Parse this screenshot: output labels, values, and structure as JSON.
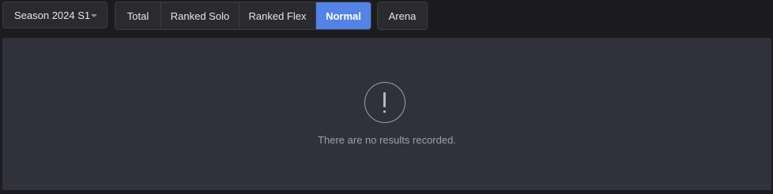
{
  "filters": {
    "season": {
      "selected": "Season 2024 S1"
    },
    "queue_tabs": [
      {
        "label": "Total",
        "active": false
      },
      {
        "label": "Ranked Solo",
        "active": false
      },
      {
        "label": "Ranked Flex",
        "active": false
      },
      {
        "label": "Normal",
        "active": true
      }
    ],
    "arena_label": "Arena"
  },
  "results": {
    "empty_icon": "exclamation-circle-icon",
    "empty_message": "There are no results recorded."
  },
  "colors": {
    "accent": "#5383e8",
    "background": "#1c1c1f",
    "panel": "#31313c"
  }
}
